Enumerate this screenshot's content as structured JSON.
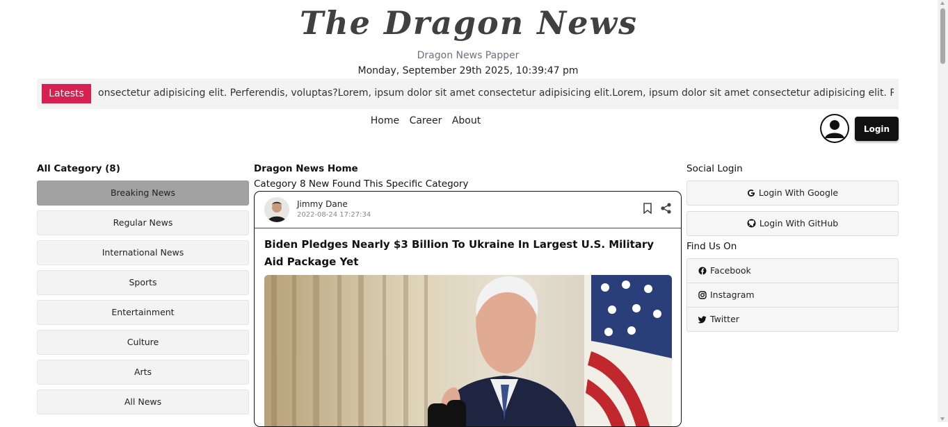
{
  "header": {
    "logo": "The Dragon News",
    "tagline": "Dragon News Papper",
    "datetime": "Monday, September 29th 2025, 10:39:47 pm"
  },
  "marquee": {
    "badge": "Latests",
    "text": "onsectetur adipisicing elit. Perferendis, voluptas?Lorem, ipsum dolor sit amet consectetur adipisicing elit.Lorem, ipsum dolor sit amet consectetur adipisicing elit. Perferendis, vo"
  },
  "nav": {
    "home": "Home",
    "career": "Career",
    "about": "About",
    "login": "Login"
  },
  "categories": {
    "title": "All Category (8)",
    "items": [
      "Breaking News",
      "Regular News",
      "International News",
      "Sports",
      "Entertainment",
      "Culture",
      "Arts",
      "All News"
    ]
  },
  "main": {
    "heading": "Dragon News Home",
    "subheading": "Category 8 New Found This Specific Category",
    "card": {
      "author": "Jimmy Dane",
      "date": "2022-08-24 17:27:34",
      "title": "Biden Pledges Nearly $3 Billion To Ukraine In Largest U.S. Military Aid Package Yet"
    }
  },
  "sidebar": {
    "social_title": "Social Login",
    "google": "Login With Google",
    "github": "Login With GitHub",
    "find_title": "Find Us On",
    "facebook": "Facebook",
    "instagram": "Instagram",
    "twitter": "Twitter"
  },
  "colors": {
    "accent": "#d72050",
    "dark": "#111111",
    "active_category": "#a3a2a3"
  }
}
